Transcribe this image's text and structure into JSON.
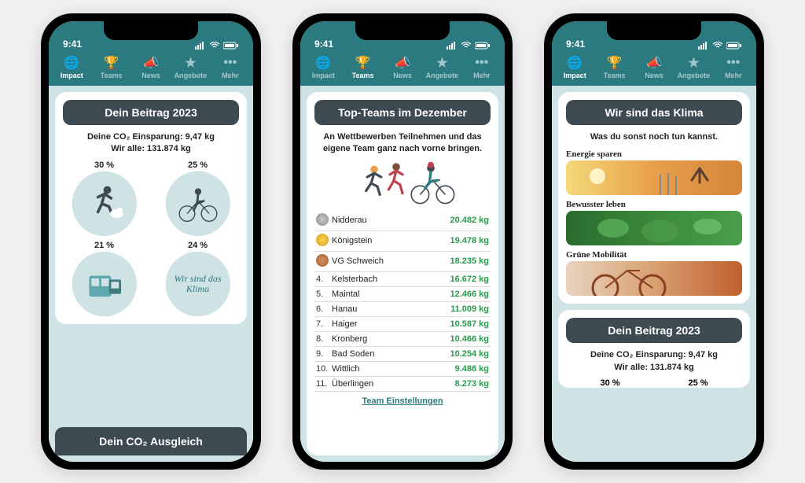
{
  "status": {
    "time": "9:41"
  },
  "tabs": [
    {
      "label": "Impact",
      "icon": "globe"
    },
    {
      "label": "Teams",
      "icon": "trophy"
    },
    {
      "label": "News",
      "icon": "megaphone"
    },
    {
      "label": "Angebote",
      "icon": "star"
    },
    {
      "label": "Mehr",
      "icon": "dots"
    }
  ],
  "phone1": {
    "card_title": "Dein Beitrag 2023",
    "line1": "Deine CO₂ Einsparung: 9,47 kg",
    "line2": "Wir alle: 131.874 kg",
    "quads": [
      {
        "pct": "30 %",
        "kind": "runner"
      },
      {
        "pct": "25 %",
        "kind": "cyclist"
      },
      {
        "pct": "21 %",
        "kind": "tram"
      },
      {
        "pct": "24 %",
        "kind": "climate-text",
        "text": "Wir sind das Klima"
      }
    ],
    "footer_title": "Dein CO₂ Ausgleich"
  },
  "phone2": {
    "card_title": "Top-Teams im Dezember",
    "subtitle": "An Wettbewerben Teilnehmen und das eigene Team ganz nach vorne bringen.",
    "teams": [
      {
        "rank": "",
        "medal": "2",
        "name": "Nidderau",
        "value": "20.482 kg"
      },
      {
        "rank": "",
        "medal": "1",
        "name": "Königstein",
        "value": "19.478 kg"
      },
      {
        "rank": "",
        "medal": "3",
        "name": "VG Schweich",
        "value": "18.235 kg"
      },
      {
        "rank": "4.",
        "name": "Kelsterbach",
        "value": "16.672 kg"
      },
      {
        "rank": "5.",
        "name": "Maintal",
        "value": "12.466 kg"
      },
      {
        "rank": "6.",
        "name": "Hanau",
        "value": "11.009 kg"
      },
      {
        "rank": "7.",
        "name": "Haiger",
        "value": "10.587 kg"
      },
      {
        "rank": "8.",
        "name": "Kronberg",
        "value": "10.466 kg"
      },
      {
        "rank": "9.",
        "name": "Bad Soden",
        "value": "10.254 kg"
      },
      {
        "rank": "10.",
        "name": "Wittlich",
        "value": "9.486 kg"
      },
      {
        "rank": "11.",
        "name": "Überlingen",
        "value": "8.273 kg"
      }
    ],
    "settings": "Team Einstellungen"
  },
  "phone3": {
    "card_title": "Wir sind das Klima",
    "subtitle": "Was du sonst noch tun kannst.",
    "cats": [
      {
        "label": "Energie sparen",
        "img": "energy"
      },
      {
        "label": "Bewusster leben",
        "img": "leben"
      },
      {
        "label": "Grüne Mobilität",
        "img": "mobil"
      }
    ],
    "card2_title": "Dein Beitrag 2023",
    "line1": "Deine CO₂ Einsparung: 9,47 kg",
    "line2": "Wir alle: 131.874 kg",
    "pct1": "30 %",
    "pct2": "25 %"
  }
}
